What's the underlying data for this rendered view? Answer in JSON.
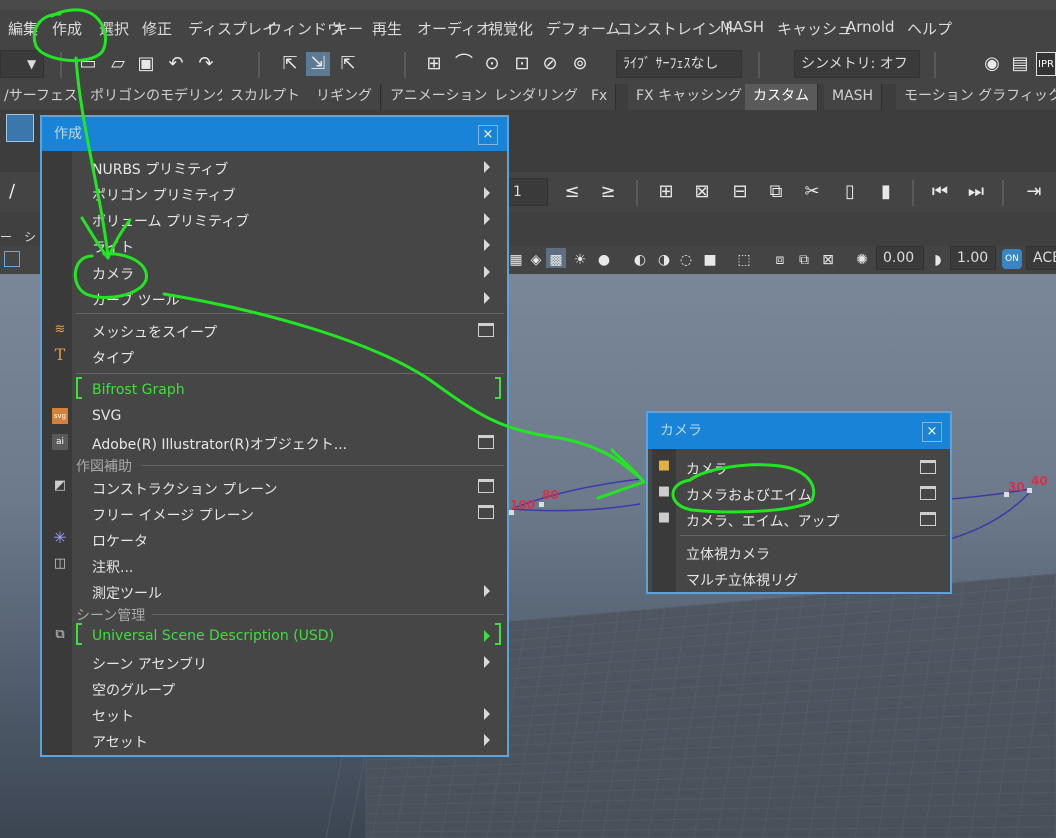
{
  "menubar": {
    "items": [
      "編集",
      "作成",
      "選択",
      "修正",
      "ディスプレイ",
      "ウィンドウ",
      "キー",
      "再生",
      "オーディオ",
      "視覚化",
      "デフォーム",
      "コンストレイント",
      "MASH",
      "キャッシュ",
      "Arnold",
      "ヘルプ"
    ]
  },
  "toolbar": {
    "live_surface": "ﾗｲﾌﾞ ｻｰﾌｪｽなし",
    "symmetry": "シンメトリ: オフ",
    "ipr_label": "IPR"
  },
  "shelf_tabs": {
    "items": [
      "/サーフェス",
      "ポリゴンのモデリング",
      "スカルプト",
      "リギング",
      "アニメーション",
      "レンダリング",
      "Fx",
      "FX キャッシング",
      "カスタム",
      "MASH",
      "モーション グラフィックス"
    ],
    "active": "カスタム"
  },
  "toolrow2": {
    "frame_value": "1"
  },
  "toolrow3": {
    "left_label": "ー　シ"
  },
  "toolrow4": {
    "value1": "0.00",
    "value2": "1.00",
    "aces": "ACE"
  },
  "create_menu": {
    "title": "作成",
    "close": "×",
    "items": [
      "NURBS プリミティブ",
      "ポリゴン プリミティブ",
      "ボリューム プリミティブ",
      "ライト",
      "カメラ",
      "カーブ ツール",
      "メッシュをスイープ",
      "タイプ",
      "Bifrost Graph",
      "SVG",
      "Adobe(R) Illustrator(R)オブジェクト...",
      "コンストラクション プレーン",
      "フリー イメージ プレーン",
      "ロケータ",
      "注釈...",
      "測定ツール",
      "Universal Scene Description (USD)",
      "シーン アセンブリ",
      "空のグループ",
      "セット",
      "アセット"
    ],
    "sections": [
      "作図補助",
      "シーン管理"
    ],
    "gutter_icons": [
      "sweep-icon",
      "type-icon",
      "svg-icon",
      "ai-icon",
      "construction-plane-icon",
      "locator-icon",
      "annotation-icon",
      "usd-icon"
    ]
  },
  "camera_menu": {
    "title": "カメラ",
    "close": "×",
    "items": [
      "カメラ",
      "カメラおよびエイム",
      "カメラ、エイム、アップ",
      "立体視カメラ",
      "マルチ立体視リグ"
    ]
  },
  "viewport": {
    "labels": [
      "100",
      "80",
      "30",
      "40"
    ]
  },
  "colors": {
    "accent_blue": "#1883d7",
    "annotation_green": "#22e622",
    "menu_green": "#3ce03c",
    "curve_blue": "#3a3aa8",
    "label_red": "#d8304a"
  }
}
